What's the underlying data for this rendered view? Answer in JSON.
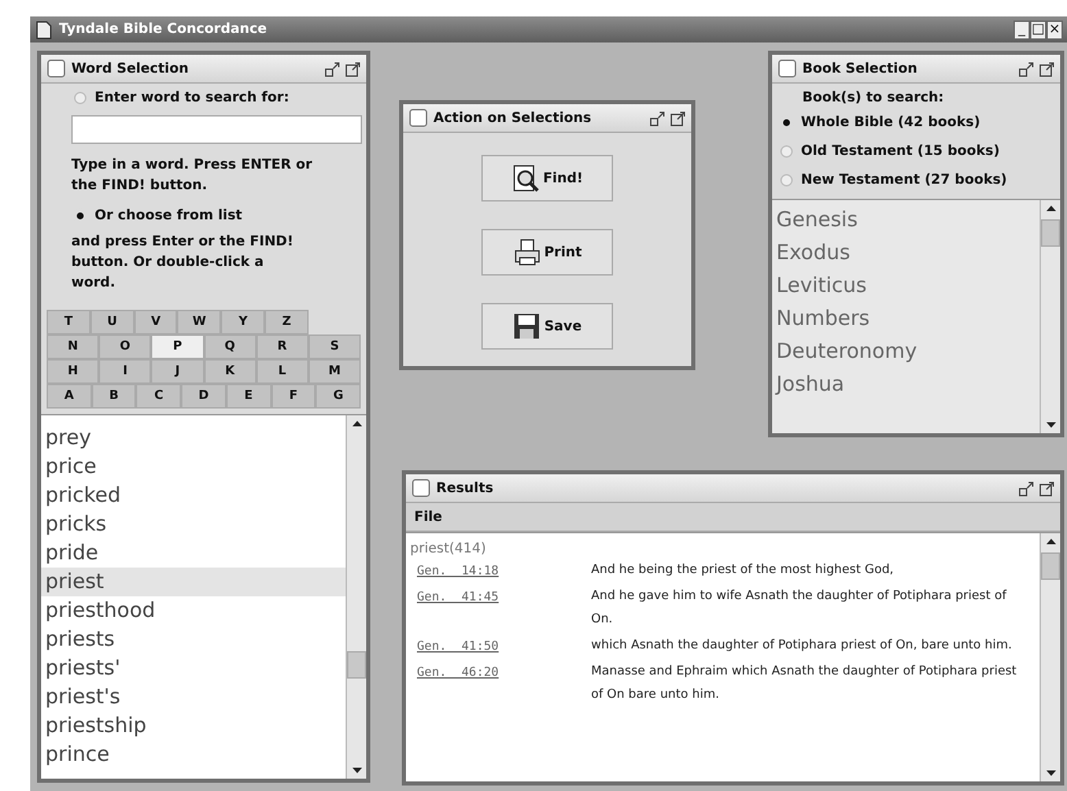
{
  "window": {
    "title": "Tyndale Bible Concordance",
    "controls": [
      "_",
      "□",
      "×"
    ]
  },
  "word_selection": {
    "title": "Word Selection",
    "options": [
      {
        "label": "Enter word to search for:",
        "selected": false
      },
      {
        "label": "Or choose from list",
        "selected": true
      }
    ],
    "help": "Type in a word. Press ENTER or the FIND! button.",
    "list_help": "and press Enter or the FIND! button. Or double-click a word.",
    "letter_tabs": [
      [
        {
          "label": "T",
          "selected": false
        },
        {
          "label": "U",
          "selected": false
        },
        {
          "label": "V",
          "selected": false
        },
        {
          "label": "W",
          "selected": false
        },
        {
          "label": "Y",
          "selected": false
        },
        {
          "label": "Z",
          "selected": false
        }
      ],
      [
        {
          "label": "N",
          "selected": false
        },
        {
          "label": "O",
          "selected": false
        },
        {
          "label": "P",
          "selected": true
        },
        {
          "label": "Q",
          "selected": false
        },
        {
          "label": "R",
          "selected": false
        },
        {
          "label": "S",
          "selected": false
        }
      ],
      [
        {
          "label": "H",
          "selected": false
        },
        {
          "label": "I",
          "selected": false
        },
        {
          "label": "J",
          "selected": false
        },
        {
          "label": "K",
          "selected": false
        },
        {
          "label": "L",
          "selected": false
        },
        {
          "label": "M",
          "selected": false
        }
      ],
      [
        {
          "label": "A",
          "selected": false
        },
        {
          "label": "B",
          "selected": false
        },
        {
          "label": "C",
          "selected": false
        },
        {
          "label": "D",
          "selected": false
        },
        {
          "label": "E",
          "selected": false
        },
        {
          "label": "F",
          "selected": false
        },
        {
          "label": "G",
          "selected": false
        }
      ]
    ],
    "words": [
      {
        "text": "prey",
        "selected": false
      },
      {
        "text": "price",
        "selected": false
      },
      {
        "text": "pricked",
        "selected": false
      },
      {
        "text": "pricks",
        "selected": false
      },
      {
        "text": "pride",
        "selected": false
      },
      {
        "text": "priest",
        "selected": true
      },
      {
        "text": "priesthood",
        "selected": false
      },
      {
        "text": "priests",
        "selected": false
      },
      {
        "text": "priests'",
        "selected": false
      },
      {
        "text": "priest's",
        "selected": false
      },
      {
        "text": "priestship",
        "selected": false
      },
      {
        "text": "prince",
        "selected": false
      }
    ]
  },
  "actions": {
    "title": "Action on Selections",
    "buttons": [
      {
        "label": "Find!",
        "kind": "find"
      },
      {
        "label": "Print",
        "kind": "print"
      },
      {
        "label": "Save",
        "kind": "save"
      }
    ]
  },
  "book_selection": {
    "title": "Book Selection",
    "prompt": "Book(s) to search:",
    "options": [
      {
        "label": "Whole Bible (42 books)",
        "selected": true
      },
      {
        "label": "Old Testament (15 books)",
        "selected": false
      },
      {
        "label": "New Testament (27 books)",
        "selected": false
      }
    ],
    "books": [
      "Genesis",
      "Exodus",
      "Leviticus",
      "Numbers",
      "Deuteronomy",
      "Joshua"
    ]
  },
  "results": {
    "title": "Results",
    "menu": [
      "File"
    ],
    "query": "priest(414)",
    "rows": [
      {
        "ref": "Gen.  14:18",
        "text": "And he being the priest of the most highest God,"
      },
      {
        "ref": "Gen.  41:45",
        "text": "And he gave him to wife Asnath the daughter of Potiphara priest of On."
      },
      {
        "ref": "Gen.  41:50",
        "text": "which Asnath the daughter of Potiphara priest of On, bare unto him."
      },
      {
        "ref": "Gen.  46:20",
        "text": "Manasse and Ephraim which Asnath the daughter of Potiphara priest of On bare unto him."
      }
    ]
  }
}
